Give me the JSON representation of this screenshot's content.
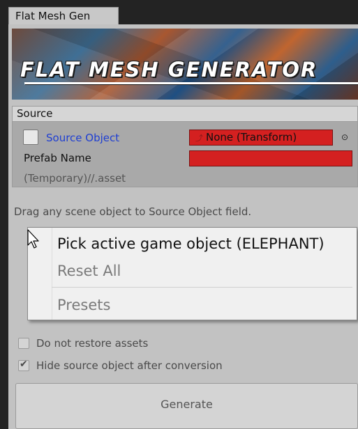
{
  "window": {
    "tab_title": "Flat Mesh Gen"
  },
  "banner": {
    "title": "FLAT MESH GENERATOR"
  },
  "source_section": {
    "header": "Source",
    "source_object_label": "Source Object",
    "source_object_value": "None (Transform)",
    "prefab_name_label": "Prefab Name",
    "prefab_name_value": "",
    "asset_path": "(Temporary)//.asset"
  },
  "hint": "Drag any scene object to Source Object field.",
  "context_menu": {
    "items": [
      {
        "label": "Pick active game object (ELEPHANT)",
        "enabled": true
      },
      {
        "label": "Reset All",
        "enabled": false
      },
      {
        "label": "Presets",
        "enabled": false
      }
    ]
  },
  "options": {
    "do_not_restore": {
      "label": "Do not restore assets",
      "checked": false
    },
    "hide_source": {
      "label": "Hide source object after conversion",
      "checked": true
    }
  },
  "generate_button": {
    "label": "Generate"
  },
  "colors": {
    "error_red": "#d42020",
    "link_blue": "#1f3fd2"
  }
}
